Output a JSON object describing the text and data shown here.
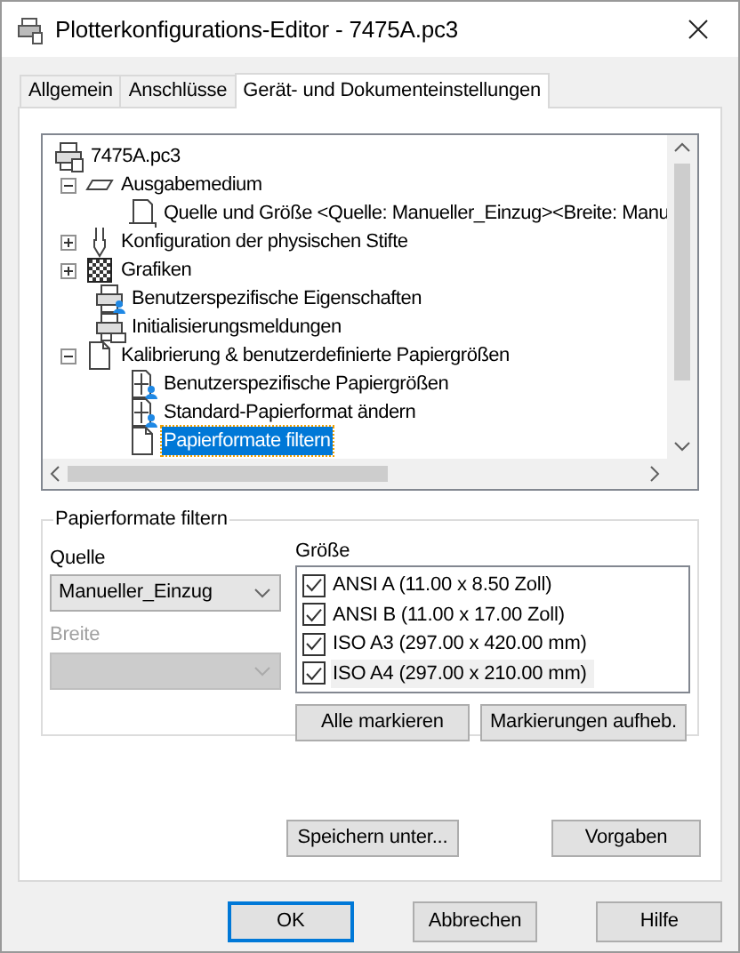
{
  "window": {
    "title": "Plotterkonfigurations-Editor - 7475A.pc3"
  },
  "tabs": [
    {
      "label": "Allgemein",
      "selected": false
    },
    {
      "label": "Anschlüsse",
      "selected": false
    },
    {
      "label": "Gerät- und Dokumenteinstellungen",
      "selected": true
    }
  ],
  "tree": [
    {
      "label": "7475A.pc3",
      "kind": "printer",
      "selected": false,
      "children": [
        {
          "label": "Ausgabemedium",
          "kind": "media",
          "expanded": true,
          "selected": false,
          "children": [
            {
              "label": "Quelle und Größe <Quelle: Manueller_Einzug><Breite: Manu",
              "kind": "paper",
              "selected": false
            }
          ]
        },
        {
          "label": "Konfiguration der physischen Stifte",
          "kind": "pen",
          "expanded": false,
          "selected": false
        },
        {
          "label": "Grafiken",
          "kind": "pattern",
          "expanded": false,
          "selected": false
        },
        {
          "label": "Benutzerspezifische Eigenschaften",
          "kind": "printer-user",
          "selected": false
        },
        {
          "label": "Initialisierungsmeldungen",
          "kind": "printer-message",
          "selected": false
        },
        {
          "label": "Kalibrierung & benutzerdefinierte Papiergrößen",
          "kind": "document",
          "expanded": true,
          "selected": false,
          "children": [
            {
              "label": "Benutzerspezifische Papiergrößen",
              "kind": "size",
              "selected": false
            },
            {
              "label": "Standard-Papierformat ändern",
              "kind": "size",
              "selected": false
            },
            {
              "label": "Papierformate filtern",
              "kind": "document",
              "selected": true
            }
          ]
        }
      ]
    }
  ],
  "filter": {
    "title": "Papierformate filtern",
    "source": {
      "label": "Quelle",
      "value": "Manueller_Einzug",
      "disabled": false
    },
    "width": {
      "label": "Breite",
      "disabled": true
    },
    "size_label": "Größe",
    "sizes": [
      {
        "label": "ANSI A (11.00 x 8.50 Zoll)",
        "checked": true,
        "selected": false
      },
      {
        "label": "ANSI B (11.00 x 17.00 Zoll)",
        "checked": true,
        "selected": false
      },
      {
        "label": "ISO A3 (297.00 x 420.00 mm)",
        "checked": true,
        "selected": false
      },
      {
        "label": "ISO A4 (297.00 x 210.00 mm)",
        "checked": true,
        "selected": true
      }
    ],
    "buttons": [
      "Alle markieren",
      "Markierungen aufheb."
    ]
  },
  "panel_buttons": [
    "Speichern unter...",
    "Vorgaben"
  ],
  "dialog_buttons": [
    {
      "label": "OK",
      "default": true
    },
    {
      "label": "Abbrechen",
      "default": false
    },
    {
      "label": "Hilfe",
      "default": false
    }
  ]
}
